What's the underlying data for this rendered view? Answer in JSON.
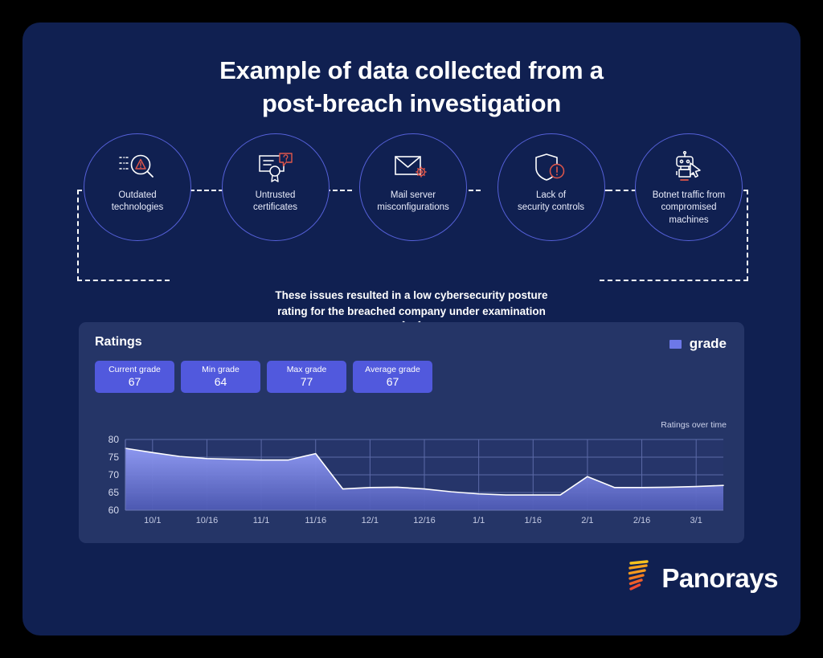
{
  "colors": {
    "outer_background": "#000000",
    "panel_background": "#102051",
    "card_background": "#253567",
    "accent_blue": "#5159dd",
    "circle_stroke": "#5560d8",
    "line_stroke": "#ffffff",
    "area_fill": "#6d78e8",
    "icon_accent_red": "#e0564a",
    "logo_orange": "#f5a01e",
    "logo_red": "#ef4a33"
  },
  "title": {
    "line1": "Example of data collected from a",
    "line2": "post-breach investigation"
  },
  "flow": {
    "nodes": [
      {
        "icon": "binary-magnifier-warning-icon",
        "label": "Outdated\ntechnologies"
      },
      {
        "icon": "certificate-question-icon",
        "label": "Untrusted\ncertificates"
      },
      {
        "icon": "mail-gear-icon",
        "label": "Mail server\nmisconfigurations"
      },
      {
        "icon": "shield-alert-icon",
        "label": "Lack of\nsecurity controls"
      },
      {
        "icon": "robot-cursor-icon",
        "label": "Botnet traffic from\ncompromised\nmachines"
      }
    ]
  },
  "caption": {
    "line1": "These issues resulted in a low cybersecurity posture",
    "line2": "rating for the breached company under examination",
    "chevron": "chevron-down-icon"
  },
  "card": {
    "title": "Ratings",
    "legend": {
      "label": "grade",
      "swatch": "grade-legend-swatch"
    },
    "chart_caption": "Ratings over time",
    "stats": [
      {
        "label": "Current grade",
        "value": "67"
      },
      {
        "label": "Min grade",
        "value": "64"
      },
      {
        "label": "Max grade",
        "value": "77"
      },
      {
        "label": "Average grade",
        "value": "67"
      }
    ]
  },
  "chart_data": {
    "type": "area",
    "title": "Ratings over time",
    "xlabel": "",
    "ylabel": "",
    "ylim": [
      60,
      80
    ],
    "yticks": [
      60,
      65,
      70,
      75,
      80
    ],
    "xticks": [
      "10/1",
      "10/16",
      "11/1",
      "11/16",
      "12/1",
      "12/16",
      "1/1",
      "1/16",
      "2/1",
      "2/16",
      "3/1"
    ],
    "grid": true,
    "legend_position": "top-right",
    "series": [
      {
        "name": "grade",
        "x": [
          "9/24",
          "10/1",
          "10/8",
          "10/16",
          "10/24",
          "11/1",
          "11/8",
          "11/12",
          "11/16",
          "11/24",
          "12/1",
          "12/8",
          "12/16",
          "12/24",
          "1/1",
          "1/8",
          "1/16",
          "1/22",
          "2/1",
          "2/8",
          "2/16",
          "2/24",
          "3/1"
        ],
        "values": [
          77.5,
          76.3,
          75.2,
          74.6,
          74.4,
          74.2,
          74.2,
          76.0,
          66.0,
          66.4,
          66.5,
          66.0,
          65.2,
          64.6,
          64.3,
          64.3,
          64.3,
          69.5,
          66.4,
          66.4,
          66.5,
          66.7,
          67.0
        ]
      }
    ]
  },
  "logo": {
    "name": "panorays-logo",
    "text": "Panorays",
    "mark": "panorays-slash-mark"
  }
}
